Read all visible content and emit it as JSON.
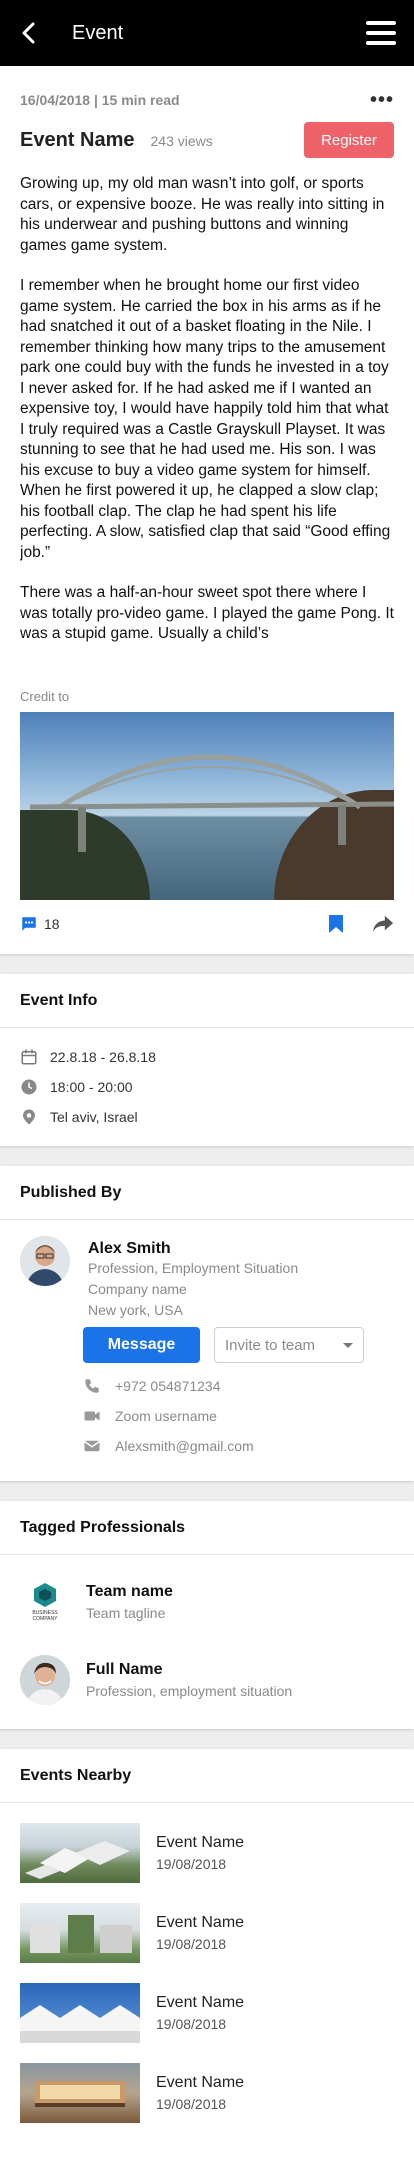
{
  "header": {
    "title": "Event"
  },
  "article": {
    "meta": "16/04/2018 | 15 min read",
    "name": "Event Name",
    "views": "243 views",
    "register_label": "Register",
    "paragraphs": [
      "Growing up, my old man wasn’t into golf, or sports cars, or expensive booze. He was really into sitting in his underwear and pushing buttons and winning games game system.",
      "I remember when he brought home our first video game system. He carried the box in his arms as if he had snatched it out of a basket floating in the Nile. I remember thinking how many trips to the amusement park one could buy with the funds he invested in a toy I never asked for. If he had asked me if I wanted an expensive toy, I would have happily told him that what I truly required was a Castle Grayskull Playset. It was stunning to see that he had used me. His son. I was his excuse to buy a video game system for himself. When he first powered it up, he clapped a slow clap; his football clap. The clap he had spent his life perfecting. A slow, satisfied clap that said “Good effing job.”",
      "There was a half-an-hour sweet spot there where I was totally pro-video game. I played the game Pong. It was a stupid game. Usually a child’s"
    ],
    "credit": "Credit to",
    "comment_count": "18"
  },
  "event_info": {
    "heading": "Event Info",
    "dates": "22.8.18 - 26.8.18",
    "time": "18:00 - 20:00",
    "location": "Tel aviv, Israel"
  },
  "published_by": {
    "heading": "Published By",
    "name": "Alex Smith",
    "profession": "Profession, Employment Situation",
    "company": "Company name",
    "city": "New york, USA",
    "message_label": "Message",
    "invite_label": "Invite to team",
    "phone": "+972 054871234",
    "zoom": "Zoom username",
    "email": "Alexsmith@gmail.com"
  },
  "tagged": {
    "heading": "Tagged Professionals",
    "items": [
      {
        "name": "Team name",
        "sub": "Team tagline",
        "logo_text": "BUSINESS COMPANY"
      },
      {
        "name": "Full Name",
        "sub": "Profession, employment situation"
      }
    ]
  },
  "nearby": {
    "heading": "Events Nearby",
    "items": [
      {
        "name": "Event Name",
        "date": "19/08/2018"
      },
      {
        "name": "Event Name",
        "date": "19/08/2018"
      },
      {
        "name": "Event Name",
        "date": "19/08/2018"
      },
      {
        "name": "Event Name",
        "date": "19/08/2018"
      }
    ]
  },
  "colors": {
    "register": "#f0626a",
    "primary": "#1a73e8",
    "topbar": "#000000"
  }
}
